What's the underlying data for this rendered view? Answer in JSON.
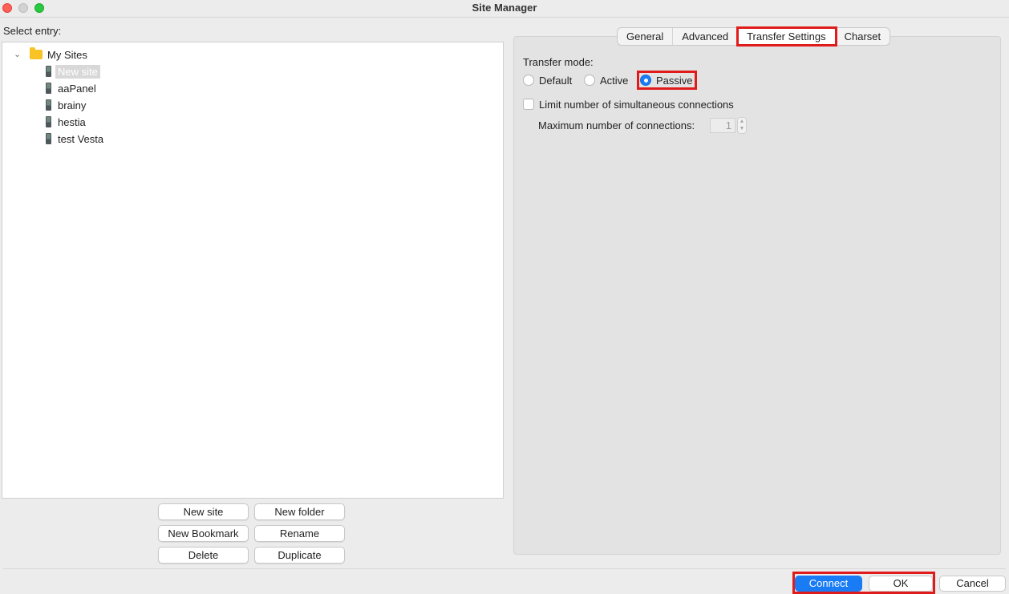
{
  "window": {
    "title": "Site Manager"
  },
  "left": {
    "select_label": "Select entry:",
    "tree": {
      "root_label": "My Sites",
      "sites": [
        "New site",
        "aaPanel",
        "brainy",
        "hestia",
        "test Vesta"
      ],
      "selected_index": 0
    },
    "buttons": {
      "new_site": "New site",
      "new_folder": "New folder",
      "new_bookmark": "New Bookmark",
      "rename": "Rename",
      "delete": "Delete",
      "duplicate": "Duplicate"
    }
  },
  "tabs": {
    "items": [
      "General",
      "Advanced",
      "Transfer Settings",
      "Charset"
    ],
    "active": "Transfer Settings"
  },
  "transfer": {
    "mode_label": "Transfer mode:",
    "modes": [
      "Default",
      "Active",
      "Passive"
    ],
    "selected_mode": "Passive",
    "limit_label": "Limit number of simultaneous connections",
    "limit_checked": false,
    "max_conn_label": "Maximum number of connections:",
    "max_conn_value": "1"
  },
  "footer": {
    "connect": "Connect",
    "ok": "OK",
    "cancel": "Cancel"
  },
  "colors": {
    "accent": "#1a7cf5",
    "highlight": "#e01b1b"
  }
}
